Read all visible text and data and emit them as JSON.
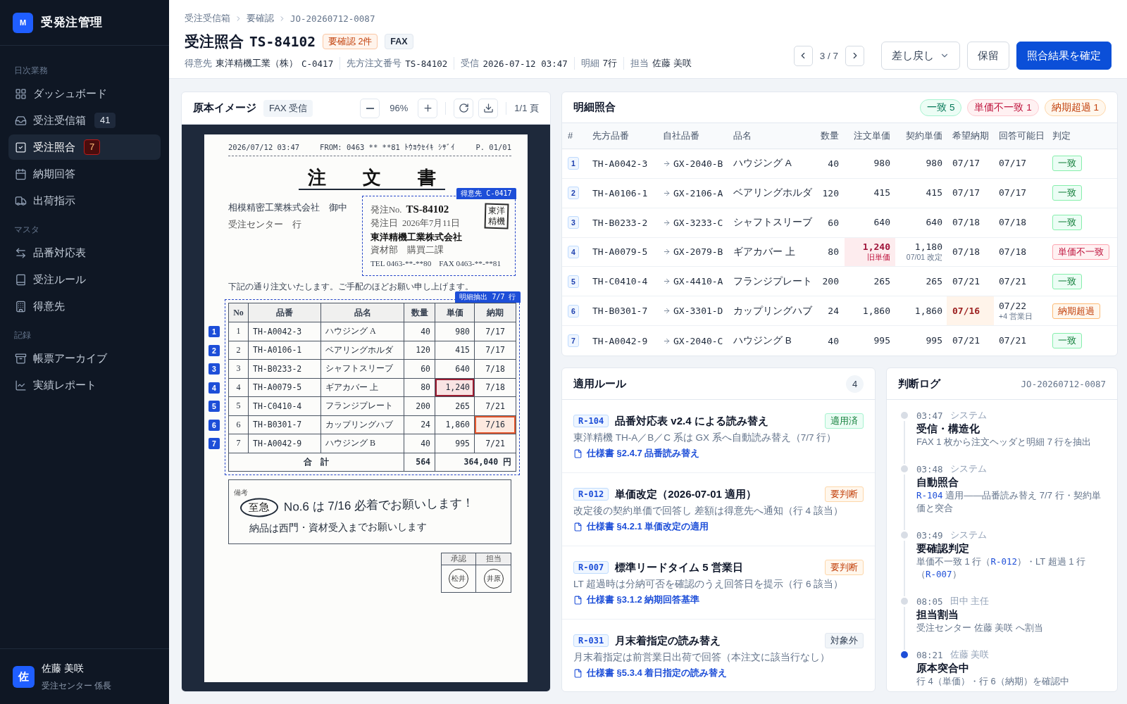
{
  "app": {
    "logo": "M",
    "name": "受発注管理"
  },
  "sidebar": {
    "sections": [
      {
        "label": "日次業務",
        "items": [
          {
            "label": "ダッシュボード",
            "selected": false
          },
          {
            "label": "受注受信箱",
            "selected": false,
            "badge": {
              "text": "41",
              "kind": "count"
            }
          },
          {
            "label": "受注照合",
            "selected": true,
            "badge": {
              "text": "7",
              "kind": "alert"
            }
          },
          {
            "label": "納期回答",
            "selected": false
          },
          {
            "label": "出荷指示",
            "selected": false
          }
        ]
      },
      {
        "label": "マスタ",
        "items": [
          {
            "label": "品番対応表",
            "selected": false
          },
          {
            "label": "受注ルール",
            "selected": false
          },
          {
            "label": "得意先",
            "selected": false
          }
        ]
      },
      {
        "label": "記録",
        "items": [
          {
            "label": "帳票アーカイブ",
            "selected": false
          },
          {
            "label": "実績レポート",
            "selected": false
          }
        ]
      }
    ],
    "user": {
      "initial": "佐",
      "name": "佐藤 美咲",
      "role": "受注センター 係長"
    }
  },
  "header": {
    "breadcrumb": [
      "受注受信箱",
      "要確認",
      "JO-20260712-0087"
    ],
    "title": "受注照合",
    "order_number": "TS-84102",
    "badges": [
      {
        "text": "要確認 2件",
        "kind": "warning"
      },
      {
        "text": "FAX",
        "kind": "neutral"
      }
    ],
    "meta": [
      {
        "label": "得意先",
        "value": "東洋精機工業（株）",
        "kind": "text",
        "code": "C-0417"
      },
      {
        "label": "先方注文番号",
        "value": "TS-84102",
        "kind": "code"
      },
      {
        "label": "受信",
        "value": "2026-07-12 03:47",
        "kind": "code"
      },
      {
        "label": "明細",
        "value": "7行",
        "kind": "text"
      },
      {
        "label": "担当",
        "value": "佐藤 美咲",
        "kind": "text"
      }
    ],
    "pager": "3 / 7",
    "actions": [
      {
        "label": "差し戻し",
        "kind": "dropdown"
      },
      {
        "label": "保留",
        "kind": "secondary"
      },
      {
        "label": "照合結果を確定",
        "kind": "primary"
      }
    ]
  },
  "source": {
    "title": "原本イメージ",
    "badge": "FAX 受信",
    "zoom": "96%",
    "page": "1/1 頁",
    "document": {
      "fax_header": [
        "2026/07/12 03:47",
        "FROM: 0463 ** **81 ﾄｳﾖｳｾｲｷ ｼｻﾞｲ",
        "P. 01/01"
      ],
      "title": "注　文　書",
      "addressee": "相模精密工業株式会社　御中",
      "addressee_dept": "受注センター　行",
      "customer": {
        "tag": "得意先 C-0417",
        "order_no_label": "発注No.",
        "order_no": "TS-84102",
        "date_label": "発注日",
        "date": "2026年7月11日",
        "company": "東洋精機工業株式会社",
        "department": "資材部　購買二課",
        "contact": "TEL 0463-**-**80　FAX 0463-**-**81",
        "stamp": "東洋精機"
      },
      "intro": "下記の通り注文いたします。ご手配のほどお願い申し上げます。",
      "table": {
        "tag": "明細抽出 7/7 行",
        "columns": [
          "No",
          "品番",
          "品名",
          "数量",
          "単価",
          "納期"
        ],
        "rows": [
          {
            "marker": "1",
            "no": "1",
            "part": "TH-A0042-3",
            "name": "ハウジング A",
            "qty": "40",
            "price": "980",
            "due": "7/17",
            "price_flagged": false,
            "due_flagged": false
          },
          {
            "marker": "2",
            "no": "2",
            "part": "TH-A0106-1",
            "name": "ベアリングホルダ",
            "qty": "120",
            "price": "415",
            "due": "7/17",
            "price_flagged": false,
            "due_flagged": false
          },
          {
            "marker": "3",
            "no": "3",
            "part": "TH-B0233-2",
            "name": "シャフトスリーブ",
            "qty": "60",
            "price": "640",
            "due": "7/18",
            "price_flagged": false,
            "due_flagged": false
          },
          {
            "marker": "4",
            "no": "4",
            "part": "TH-A0079-5",
            "name": "ギアカバー 上",
            "qty": "80",
            "price": "1,240",
            "due": "7/18",
            "price_flagged": true,
            "due_flagged": false
          },
          {
            "marker": "5",
            "no": "5",
            "part": "TH-C0410-4",
            "name": "フランジプレート",
            "qty": "200",
            "price": "265",
            "due": "7/21",
            "price_flagged": false,
            "due_flagged": false
          },
          {
            "marker": "6",
            "no": "6",
            "part": "TH-B0301-7",
            "name": "カップリングハブ",
            "qty": "24",
            "price": "1,860",
            "due": "7/16",
            "price_flagged": false,
            "due_flagged": true
          },
          {
            "marker": "7",
            "no": "7",
            "part": "TH-A0042-9",
            "name": "ハウジング B",
            "qty": "40",
            "price": "995",
            "due": "7/21",
            "price_flagged": false,
            "due_flagged": false
          }
        ],
        "total": {
          "label": "合　計",
          "qty": "564",
          "amount": "364,040 円"
        }
      },
      "remarks": {
        "label": "備考",
        "urgent": "至急",
        "lines": [
          "No.6 は 7/16 必着でお願いします！",
          "納品は西門・資材受入までお願いします"
        ]
      },
      "approvals": [
        {
          "role": "承認",
          "seal": "松井"
        },
        {
          "role": "担当",
          "seal": "井原"
        }
      ]
    }
  },
  "match": {
    "title": "明細照合",
    "summary": [
      {
        "text": "一致 5",
        "kind": "ok"
      },
      {
        "text": "単価不一致 1",
        "kind": "price"
      },
      {
        "text": "納期超過 1",
        "kind": "late"
      }
    ],
    "columns": [
      "#",
      "先方品番",
      "自社品番",
      "品名",
      "数量",
      "注文単価",
      "契約単価",
      "希望納期",
      "回答可能日",
      "判定"
    ],
    "rows": [
      {
        "no": "1",
        "customer_part": "TH-A0042-3",
        "own_part": "GX-2040-B",
        "name": "ハウジング A",
        "qty": "40",
        "order_price": "980",
        "contract_price": "980",
        "requested": "07/17",
        "available": "07/17",
        "price_flagged": false,
        "due_flagged": false,
        "result": {
          "text": "一致",
          "kind": "ok"
        }
      },
      {
        "no": "2",
        "customer_part": "TH-A0106-1",
        "own_part": "GX-2106-A",
        "name": "ベアリングホルダ",
        "qty": "120",
        "order_price": "415",
        "contract_price": "415",
        "requested": "07/17",
        "available": "07/17",
        "price_flagged": false,
        "due_flagged": false,
        "result": {
          "text": "一致",
          "kind": "ok"
        }
      },
      {
        "no": "3",
        "customer_part": "TH-B0233-2",
        "own_part": "GX-3233-C",
        "name": "シャフトスリーブ",
        "qty": "60",
        "order_price": "640",
        "contract_price": "640",
        "requested": "07/18",
        "available": "07/18",
        "price_flagged": false,
        "due_flagged": false,
        "result": {
          "text": "一致",
          "kind": "ok"
        }
      },
      {
        "no": "4",
        "customer_part": "TH-A0079-5",
        "own_part": "GX-2079-B",
        "name": "ギアカバー 上",
        "qty": "80",
        "order_price": "1,240",
        "order_price_note": "旧単価",
        "contract_price": "1,180",
        "contract_price_note": "07/01 改定",
        "requested": "07/18",
        "available": "07/18",
        "price_flagged": true,
        "due_flagged": false,
        "result": {
          "text": "単価不一致",
          "kind": "price"
        }
      },
      {
        "no": "5",
        "customer_part": "TH-C0410-4",
        "own_part": "GX-4410-A",
        "name": "フランジプレート",
        "qty": "200",
        "order_price": "265",
        "contract_price": "265",
        "requested": "07/21",
        "available": "07/21",
        "price_flagged": false,
        "due_flagged": false,
        "result": {
          "text": "一致",
          "kind": "ok"
        }
      },
      {
        "no": "6",
        "customer_part": "TH-B0301-7",
        "own_part": "GX-3301-D",
        "name": "カップリングハブ",
        "qty": "24",
        "order_price": "1,860",
        "contract_price": "1,860",
        "requested": "07/16",
        "available": "07/22",
        "available_note": "+4 営業日",
        "price_flagged": false,
        "due_flagged": true,
        "result": {
          "text": "納期超過",
          "kind": "late"
        }
      },
      {
        "no": "7",
        "customer_part": "TH-A0042-9",
        "own_part": "GX-2040-C",
        "name": "ハウジング B",
        "qty": "40",
        "order_price": "995",
        "contract_price": "995",
        "requested": "07/21",
        "available": "07/21",
        "price_flagged": false,
        "due_flagged": false,
        "result": {
          "text": "一致",
          "kind": "ok"
        }
      }
    ]
  },
  "rules": {
    "title": "適用ルール",
    "count": "4",
    "items": [
      {
        "code": "R-104",
        "title": "品番対応表 v2.4 による読み替え",
        "status": {
          "text": "適用済",
          "kind": "applied"
        },
        "description": "東洋精機 TH-A／B／C 系は GX 系へ自動読み替え（7/7 行）",
        "link": "仕様書 §2.4.7 品番読み替え"
      },
      {
        "code": "R-012",
        "title": "単価改定（2026-07-01 適用）",
        "status": {
          "text": "要判断",
          "kind": "review"
        },
        "description": "改定後の契約単価で回答し 差額は得意先へ通知（行 4 該当）",
        "link": "仕様書 §4.2.1 単価改定の適用"
      },
      {
        "code": "R-007",
        "title": "標準リードタイム 5 営業日",
        "status": {
          "text": "要判断",
          "kind": "review"
        },
        "description": "LT 超過時は分納可否を確認のうえ回答日を提示（行 6 該当）",
        "link": "仕様書 §3.1.2 納期回答基準"
      },
      {
        "code": "R-031",
        "title": "月末着指定の読み替え",
        "status": {
          "text": "対象外",
          "kind": "excluded"
        },
        "description": "月末着指定は前営業日出荷で回答（本注文に該当行なし）",
        "link": "仕様書 §5.3.4 着日指定の読み替え"
      }
    ]
  },
  "log": {
    "title": "判断ログ",
    "ref": "JO-20260712-0087",
    "entries": [
      {
        "time": "03:47",
        "actor": "システム",
        "title": "受信・構造化",
        "description": [
          {
            "text": "FAX 1 枚から注文ヘッダと明細 7 行を抽出",
            "kind": "text"
          }
        ],
        "current": false
      },
      {
        "time": "03:48",
        "actor": "システム",
        "title": "自動照合",
        "description": [
          {
            "text": "R-104",
            "kind": "link"
          },
          {
            "text": " 適用——品番読み替え 7/7 行・契約単価と突合",
            "kind": "text"
          }
        ],
        "current": false
      },
      {
        "time": "03:49",
        "actor": "システム",
        "title": "要確認判定",
        "description": [
          {
            "text": "単価不一致 1 行（",
            "kind": "text"
          },
          {
            "text": "R-012",
            "kind": "link"
          },
          {
            "text": "）・LT 超過 1 行（",
            "kind": "text"
          },
          {
            "text": "R-007",
            "kind": "link"
          },
          {
            "text": "）",
            "kind": "text"
          }
        ],
        "current": false
      },
      {
        "time": "08:05",
        "actor": "田中 主任",
        "title": "担当割当",
        "description": [
          {
            "text": "受注センター 佐藤 美咲 へ割当",
            "kind": "text"
          }
        ],
        "current": false
      },
      {
        "time": "08:21",
        "actor": "佐藤 美咲",
        "title": "原本突合中",
        "description": [
          {
            "text": "行 4（単価）・行 6（納期）を確認中",
            "kind": "text"
          }
        ],
        "current": true
      }
    ]
  }
}
